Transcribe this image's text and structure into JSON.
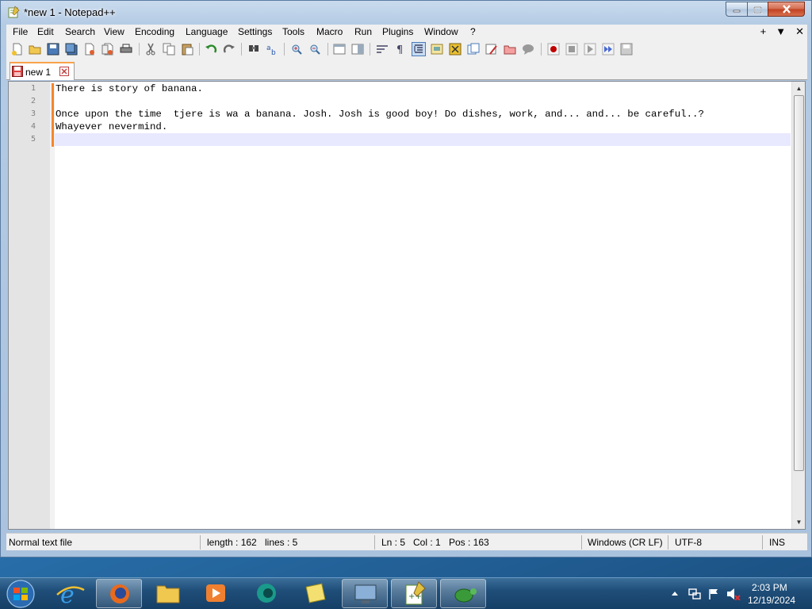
{
  "window": {
    "title": "*new 1 - Notepad++"
  },
  "menu": [
    "File",
    "Edit",
    "Search",
    "View",
    "Encoding",
    "Language",
    "Settings",
    "Tools",
    "Macro",
    "Run",
    "Plugins",
    "Window",
    "?"
  ],
  "menu_right": {
    "plus": "+",
    "down": "▼",
    "close": "✕"
  },
  "tabs": [
    {
      "label": "new 1",
      "modified": true
    }
  ],
  "editor": {
    "line_numbers": [
      "1",
      "2",
      "3",
      "4",
      "5"
    ],
    "lines": [
      "There is story of banana.",
      "",
      "Once upon the time  tjere is wa a banana. Josh. Josh is good boy! Do dishes, work, and... and... be careful..?",
      "Whayever nevermind.",
      ""
    ],
    "current_line": 5
  },
  "status": {
    "file_type": "Normal text file",
    "length": "length : 162",
    "lines": "lines : 5",
    "ln": "Ln : 5",
    "col": "Col : 1",
    "pos": "Pos : 163",
    "eol": "Windows (CR LF)",
    "encoding": "UTF-8",
    "mode": "INS"
  },
  "taskbar": {
    "apps": [
      "internet-explorer",
      "firefox",
      "file-explorer",
      "media-player",
      "app-teal",
      "sticky-notes",
      "remote-desktop",
      "notepad-plus-plus",
      "python-turtle"
    ],
    "active_app": "notepad-plus-plus"
  },
  "clock": {
    "time": "2:03 PM",
    "date": "12/19/2024"
  },
  "colors": {
    "accent": "#f5862d",
    "current_line": "#e8e8ff",
    "gutter": "#e4e4e4"
  }
}
